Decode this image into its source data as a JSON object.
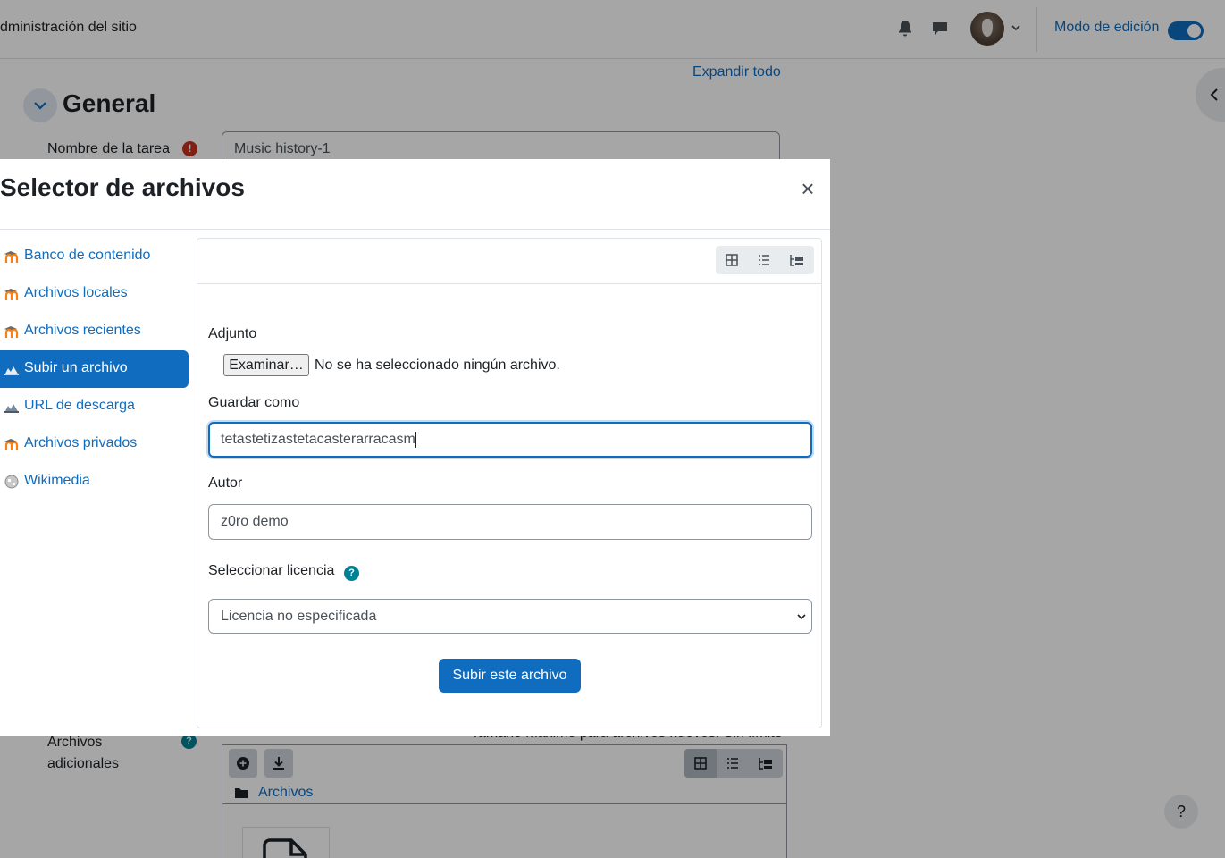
{
  "topbar": {
    "site_admin": "dministración del sitio",
    "edit_mode_label": "Modo de edición"
  },
  "page": {
    "expand_all": "Expandir todo",
    "section_title": "General",
    "task_name_label": "Nombre de la tarea",
    "task_name_value": "Music history-1",
    "required_mark": "!",
    "extra_files_label": "Archivos adicionales",
    "max_size_text": "Tamaño máximo para archivos nuevos: Sin límite",
    "files_path": "Archivos",
    "help_button": "?"
  },
  "dialog": {
    "title": "Selector de archivos",
    "close": "×",
    "repositories": [
      {
        "label": "Banco de contenido",
        "icon": "moodle-icon"
      },
      {
        "label": "Archivos locales",
        "icon": "moodle-icon"
      },
      {
        "label": "Archivos recientes",
        "icon": "moodle-icon"
      },
      {
        "label": "Subir un archivo",
        "icon": "upload-icon"
      },
      {
        "label": "URL de descarga",
        "icon": "url-download-icon"
      },
      {
        "label": "Archivos privados",
        "icon": "moodle-icon"
      },
      {
        "label": "Wikimedia",
        "icon": "wikimedia-icon"
      }
    ],
    "active_repository_index": 3,
    "form": {
      "attachment_label": "Adjunto",
      "browse_button": "Examinar…",
      "no_file_selected": "No se ha seleccionado ningún archivo.",
      "save_as_label": "Guardar como",
      "save_as_value": "tetastetizastetacasterarracasm",
      "author_label": "Autor",
      "author_value": "z0ro demo",
      "license_label": "Seleccionar licencia",
      "license_help": "?",
      "license_selected": "Licencia no especificada",
      "upload_button": "Subir este archivo"
    }
  },
  "colors": {
    "accent": "#0f6cbf",
    "required": "#ca3120",
    "help": "#008196",
    "backdrop": "rgba(0,0,0,0.35)"
  }
}
